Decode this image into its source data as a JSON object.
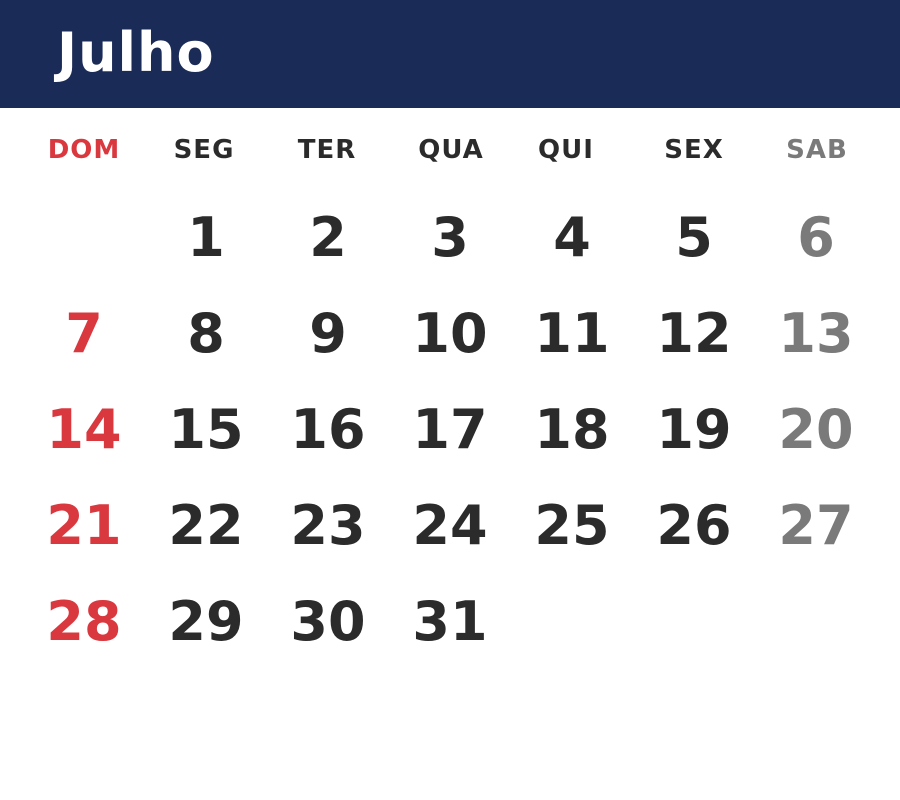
{
  "calendar": {
    "month": "Julho",
    "weekdays": [
      "DOM",
      "SEG",
      "TER",
      "QUA",
      "QUI",
      "SEX",
      "SAB"
    ],
    "weeks": [
      [
        "",
        "1",
        "2",
        "3",
        "4",
        "5",
        "6"
      ],
      [
        "7",
        "8",
        "9",
        "10",
        "11",
        "12",
        "13"
      ],
      [
        "14",
        "15",
        "16",
        "17",
        "18",
        "19",
        "20"
      ],
      [
        "21",
        "22",
        "23",
        "24",
        "25",
        "26",
        "27"
      ],
      [
        "28",
        "29",
        "30",
        "31",
        "",
        "",
        ""
      ]
    ]
  },
  "colors": {
    "header_background": "#1b2b57",
    "header_text": "#ffffff",
    "sunday": "#d9383f",
    "weekday": "#2b2b2b",
    "saturday": "#7a7a7a"
  }
}
